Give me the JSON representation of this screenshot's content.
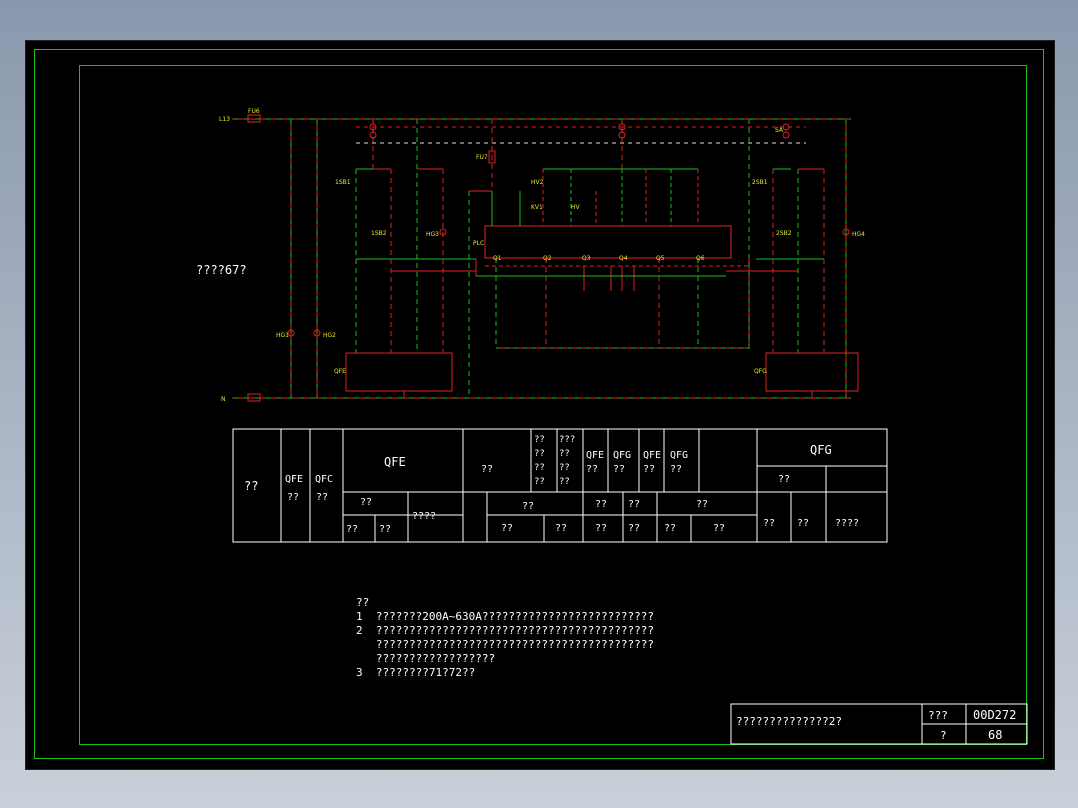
{
  "left_label": "????67?",
  "table": {
    "col1": "??",
    "qfe_top": "QFE",
    "qfe_top_sub": "??",
    "qfc_top": "QFC",
    "qfc_top_sub": "??",
    "qfe_header": "QFE",
    "qfe_sub1": "??",
    "qfe_sub2": "????",
    "qfe_sub1a": "??",
    "qfe_sub1b": "??",
    "mid_label": "??",
    "small1": "??\n??\n??\n??",
    "small2": "???\n??\n??\n??",
    "qfe2": "QFE\n??",
    "qfg2": "QFG\n??",
    "qfe3": "QFE\n??",
    "qfg3": "QFG\n??",
    "r2_a": "??",
    "r2_b": "??",
    "r2_c": "??",
    "r2_d": "??",
    "r3_a": "??",
    "r3_b": "??",
    "r3_c": "??",
    "r3_d": "??",
    "r3_e": "??",
    "r3_f": "??",
    "qfg_header": "QFG",
    "qfg_sub1": "??",
    "qfg_sub1a": "??",
    "qfg_sub1b": "??",
    "qfg_sub2": "????"
  },
  "notes": {
    "heading": "??",
    "line1": "1  ???????200A~630A??????????????????????????",
    "line2a": "2  ??????????????????????????????????????????",
    "line2b": "   ??????????????????????????????????????????",
    "line2c": "   ??????????????????",
    "line3": "3  ????????71?72??"
  },
  "title_block": {
    "title": "??????????????2?",
    "label_a": "???",
    "value_a": "00D272",
    "label_b": "?",
    "value_b": "68"
  },
  "schematic_labels": {
    "l13": "L13",
    "n": "N",
    "fu6": "FU6",
    "fu7": "FU7",
    "sa": "SA",
    "sb1_1": "1SB1",
    "sb2_1": "1SB2",
    "sb1_2": "2SB1",
    "sb2_2": "2SB2",
    "hg1": "HG1",
    "hg2": "HG2",
    "hg3": "HG3",
    "hg4": "HG4",
    "plc": "PLC",
    "qfe_box": "QFE",
    "qfg_box": "QFG",
    "q1": "Q1",
    "q2": "Q2",
    "q3": "Q3",
    "q4": "Q4",
    "q5": "Q5",
    "q6": "Q6",
    "hv2": "HV2",
    "kv1": "KV1",
    "hv": "HV"
  },
  "colors": {
    "wire_green": "#18c018",
    "wire_red": "#e02020",
    "label_yellow": "#e8e830",
    "text": "#ffffff"
  }
}
